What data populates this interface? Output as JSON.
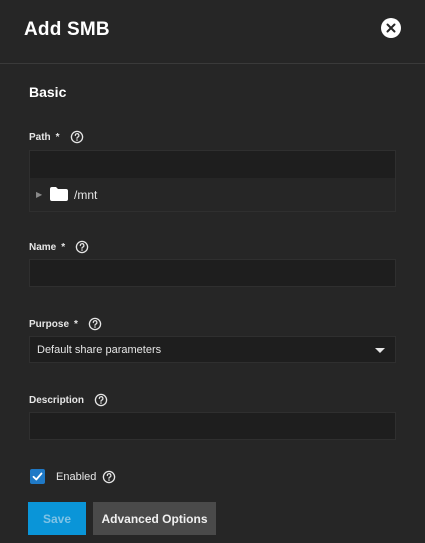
{
  "dialog": {
    "title": "Add SMB",
    "section_basic": "Basic"
  },
  "path": {
    "label": "Path",
    "required_mark": "*",
    "value": "",
    "tree_root": "/mnt"
  },
  "name": {
    "label": "Name",
    "required_mark": "*",
    "value": ""
  },
  "purpose": {
    "label": "Purpose",
    "required_mark": "*",
    "selected": "Default share parameters"
  },
  "description": {
    "label": "Description",
    "value": ""
  },
  "enabled": {
    "label": "Enabled",
    "checked": true
  },
  "buttons": {
    "save": "Save",
    "advanced": "Advanced Options"
  },
  "icons": {
    "close": "close-icon",
    "help": "help-icon",
    "folder": "folder-icon",
    "expand": "triangle-right-icon",
    "dropdown": "caret-down-icon",
    "check": "check-icon"
  },
  "colors": {
    "background": "#262626",
    "field_bg": "#1e1e1e",
    "primary": "#0a95d8",
    "checkbox": "#1f79c6",
    "secondary_button": "#4a4a4a"
  }
}
